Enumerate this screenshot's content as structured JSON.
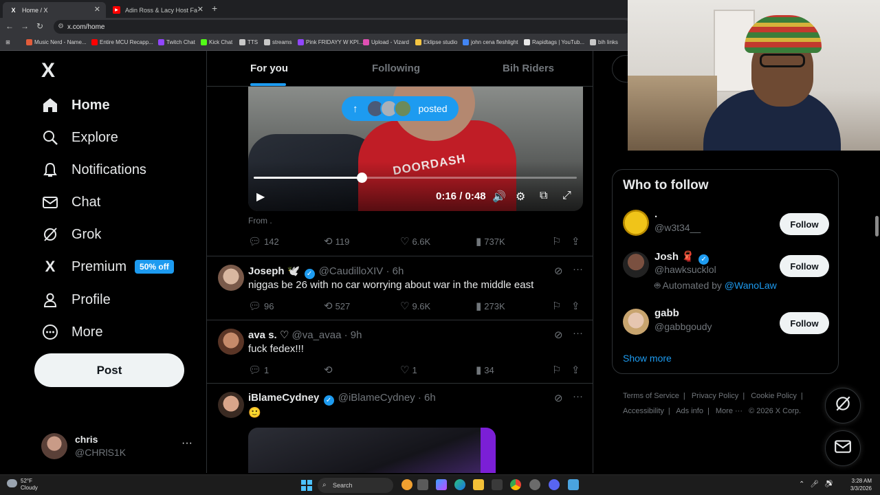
{
  "browser": {
    "tabs": [
      {
        "title": "Home / X",
        "favicon": "x-logo",
        "active": true
      },
      {
        "title": "Adin Ross & Lacy Host Fat Cam",
        "favicon": "youtube-logo",
        "active": false
      }
    ],
    "url": "x.com/home",
    "bookmarks": [
      {
        "label": "Music Nerd - Name...",
        "color": "#e25c3b"
      },
      {
        "label": "Entire MCU Recapp...",
        "color": "#ff0000"
      },
      {
        "label": "Twitch Chat",
        "color": "#9146ff"
      },
      {
        "label": "Kick Chat",
        "color": "#53fc18"
      },
      {
        "label": "TTS",
        "color": "#c8c8c8"
      },
      {
        "label": "streams",
        "color": "#c8c8c8"
      },
      {
        "label": "Pink FRIDAYY W KPI...",
        "color": "#9146ff"
      },
      {
        "label": "Upload - Vizard",
        "color": "#e04fb3"
      },
      {
        "label": "Eklipse studio",
        "color": "#f5c542"
      },
      {
        "label": "john cena fleshlight",
        "color": "#4285f4"
      },
      {
        "label": "Rapidtags | YouTub...",
        "color": "#e8e8e8"
      },
      {
        "label": "bih links",
        "color": "#c8c8c8"
      }
    ]
  },
  "sidebar": {
    "logo": "X",
    "items": [
      {
        "label": "Home",
        "icon": "home-icon",
        "glyph": "⌂",
        "bold": true
      },
      {
        "label": "Explore",
        "icon": "search-icon",
        "glyph": "⌕"
      },
      {
        "label": "Notifications",
        "icon": "bell-icon",
        "glyph": "🔔"
      },
      {
        "label": "Chat",
        "icon": "mail-icon",
        "glyph": "✉"
      },
      {
        "label": "Grok",
        "icon": "grok-icon",
        "glyph": "⊘"
      },
      {
        "label": "Premium",
        "icon": "x-icon",
        "glyph": "X",
        "badge": "50% off"
      },
      {
        "label": "Profile",
        "icon": "person-icon",
        "glyph": "☺"
      },
      {
        "label": "More",
        "icon": "more-circle-icon",
        "glyph": "⋯"
      }
    ],
    "post_label": "Post",
    "account": {
      "name": "chris",
      "handle": "@CHRlS1K"
    }
  },
  "feed": {
    "tabs": [
      "For you",
      "Following",
      "Bih Riders"
    ],
    "active_tab": 0,
    "posted_pill": {
      "label": "posted"
    },
    "video": {
      "brand_text": "DOORDASH",
      "time": "0:16 / 0:48",
      "progress_fraction": 0.333
    },
    "first_post": {
      "from": "From .",
      "stats": {
        "replies": "142",
        "reposts": "119",
        "likes": "6.6K",
        "views": "737K"
      }
    },
    "tweets": [
      {
        "name": "Joseph 🕊️",
        "handle": "@CaudilloXIV · 6h",
        "verified": true,
        "text": "niggas be 26 with no car worrying about war in the middle east",
        "stats": {
          "replies": "96",
          "reposts": "527",
          "likes": "9.6K",
          "views": "273K"
        }
      },
      {
        "name": "ava s. ♡",
        "handle": "@va_avaa · 9h",
        "verified": false,
        "text": "fuck fedex!!!",
        "stats": {
          "replies": "1",
          "reposts": "",
          "likes": "1",
          "views": "34"
        }
      },
      {
        "name": "iBlameCydney",
        "handle": "@iBlameCydney · 6h",
        "verified": true,
        "text": "🙂",
        "stats": null
      }
    ]
  },
  "right": {
    "who_to_follow": {
      "title": "Who to follow",
      "accounts": [
        {
          "name": ".",
          "handle": "@w3t34__",
          "verified": false,
          "automated_by": null
        },
        {
          "name": "Josh 🧣",
          "handle": "@hawksucklol",
          "verified": true,
          "automated_prefix": "Automated by ",
          "automated_by": "@WanoLaw"
        },
        {
          "name": "gabb",
          "handle": "@gabbgoudy",
          "verified": false,
          "automated_by": null
        }
      ],
      "follow_label": "Follow",
      "show_more": "Show more"
    },
    "footer_links": [
      "Terms of Service",
      "|",
      "Privacy Policy",
      "|",
      "Cookie Policy",
      "|",
      "Accessibility",
      "|",
      "Ads info",
      "|",
      "More ···",
      "© 2026 X Corp."
    ]
  },
  "taskbar": {
    "weather_temp": "52°F",
    "weather_desc": "Cloudy",
    "search_label": "Search",
    "time": "3:28 AM",
    "date": "3/3/2026"
  }
}
